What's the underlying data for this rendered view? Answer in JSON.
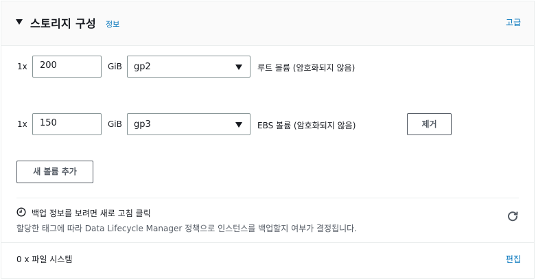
{
  "header": {
    "title": "스토리지 구성",
    "info_link": "정보",
    "advanced_link": "고급"
  },
  "volumes": [
    {
      "multiplier": "1x",
      "size": "200",
      "unit": "GiB",
      "volume_type": "gp2",
      "label": "루트 볼륨  (암호화되지 않음)"
    },
    {
      "multiplier": "1x",
      "size": "150",
      "unit": "GiB",
      "volume_type": "gp3",
      "label": "EBS 볼륨  (암호화되지 않음)",
      "remove_button": "제거"
    }
  ],
  "add_volume_button": "새 볼륨 추가",
  "backup": {
    "title": "백업 정보를 보려면 새로 고침 클릭",
    "description": "할당한 태그에 따라 Data Lifecycle Manager 정책으로 인스턴스를 백업할지 여부가 결정됩니다.",
    "icons": {
      "status": "clock-icon",
      "refresh": "refresh-icon"
    }
  },
  "file_systems": {
    "label": "0 x 파일 시스템",
    "edit_link": "편집"
  },
  "colors": {
    "link": "#0073bb",
    "text": "#16191f",
    "secondary_text": "#545b64",
    "border": "#879596"
  }
}
